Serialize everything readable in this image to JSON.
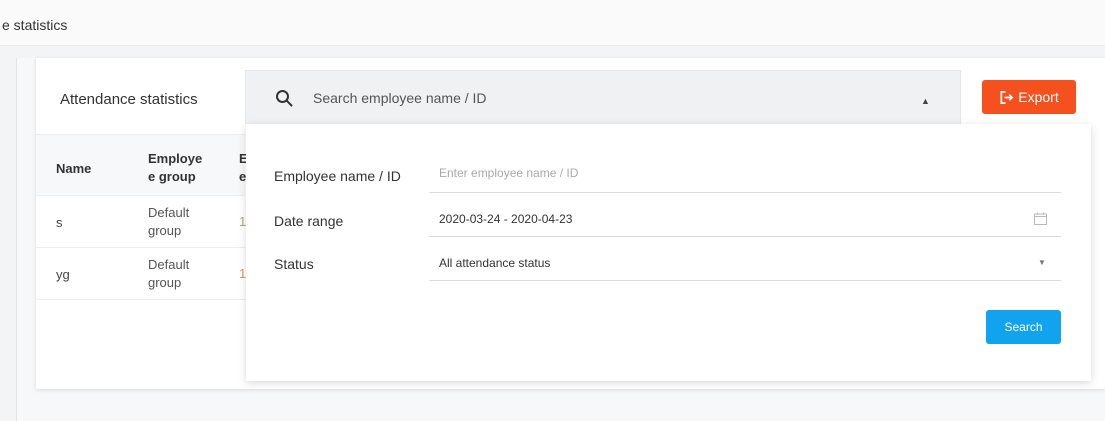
{
  "breadcrumb": {
    "text": "e statistics"
  },
  "card": {
    "title": "Attendance statistics"
  },
  "search_bar": {
    "placeholder": "Search employee name / ID"
  },
  "export": {
    "label": "Export"
  },
  "table": {
    "headers": {
      "name": "Name",
      "group": "Employe e group",
      "cut": "E e"
    },
    "rows": [
      {
        "name": "s",
        "group": "Default group",
        "cut": "1"
      },
      {
        "name": "yg",
        "group": "Default group",
        "cut": "1"
      }
    ]
  },
  "filter": {
    "employee_label": "Employee name / ID",
    "employee_placeholder": "Enter employee name / ID",
    "employee_value": "",
    "date_label": "Date range",
    "date_value": "2020-03-24 - 2020-04-23",
    "status_label": "Status",
    "status_value": "All attendance status",
    "search_label": "Search"
  },
  "colors": {
    "export": "#f4511e",
    "search": "#12a3ee"
  }
}
